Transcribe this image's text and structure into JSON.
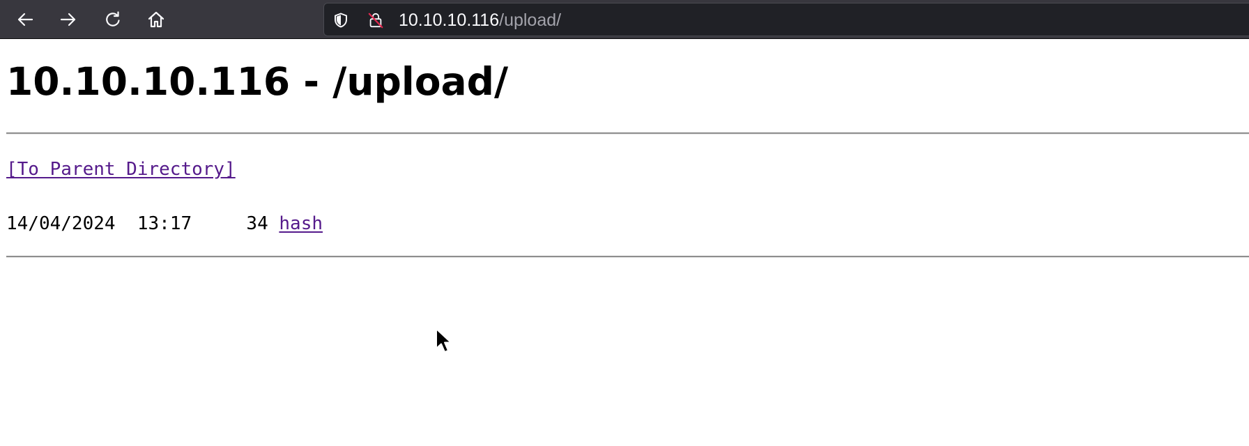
{
  "browser": {
    "nav_icons": [
      "back-arrow-icon",
      "forward-arrow-icon",
      "reload-icon",
      "home-icon"
    ],
    "url": {
      "host": "10.10.10.116",
      "path": "/upload/",
      "security_icons": [
        "shield-icon",
        "insecure-lock-icon"
      ]
    },
    "colors": {
      "toolbar": "#38373e",
      "urlbar": "#202126",
      "url_host": "#fbfbfe",
      "url_path": "#a3a3ab"
    }
  },
  "page": {
    "title": "10.10.10.116 - /upload/",
    "parent_link": "[To Parent Directory]",
    "files": [
      {
        "date": "14/04/2024",
        "time": "13:17",
        "size": "34",
        "name": "hash"
      }
    ],
    "colors": {
      "link": "#551a8b",
      "text": "#000000",
      "background": "#ffffff"
    }
  }
}
